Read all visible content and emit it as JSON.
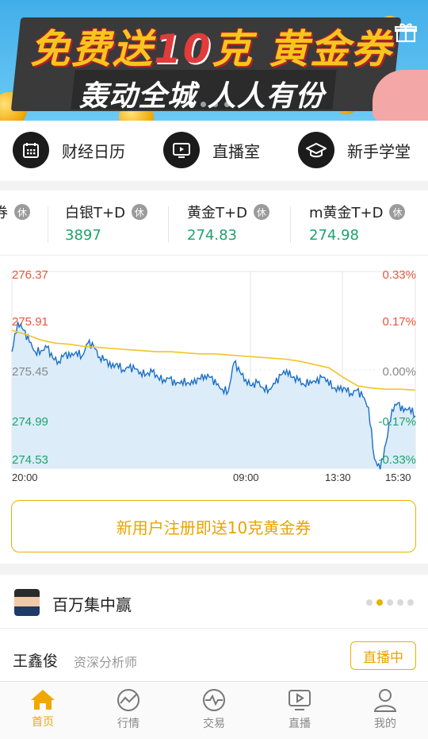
{
  "banner": {
    "title_part1": "免费送",
    "title_part2": "10",
    "title_part3": "克",
    "title_part4": "黄金券",
    "subtitle": "轰动全城 人人有份",
    "slide_count": 4,
    "active_slide": 0
  },
  "quick_menu": [
    {
      "label": "财经日历",
      "icon": "calendar-icon"
    },
    {
      "label": "直播室",
      "icon": "video-play-icon"
    },
    {
      "label": "新手学堂",
      "icon": "graduation-cap-icon"
    }
  ],
  "tickers": [
    {
      "name": "券",
      "status": "休",
      "price": ""
    },
    {
      "name": "白银T+D",
      "status": "休",
      "price": "3897"
    },
    {
      "name": "黄金T+D",
      "status": "休",
      "price": "274.83"
    },
    {
      "name": "m黄金T+D",
      "status": "休",
      "price": "274.98"
    }
  ],
  "chart": {
    "left_labels": [
      "276.37",
      "275.91",
      "275.45",
      "274.99",
      "274.53"
    ],
    "right_labels": [
      "0.33%",
      "0.17%",
      "0.00%",
      "-0.17%",
      "-0.33%"
    ],
    "x_labels": [
      "20:00",
      "09:00",
      "13:30",
      "15:30"
    ],
    "colors": {
      "up": "#e8553a",
      "flat": "#888888",
      "down": "#1ea36b",
      "price": "#1b6fc6",
      "avg": "#f2c428",
      "fill": "#dcecf9"
    }
  },
  "chart_data": {
    "type": "line",
    "ylim": [
      274.53,
      276.37
    ],
    "x_labels": [
      "20:00",
      "09:00",
      "13:30",
      "15:30"
    ],
    "series": [
      {
        "values": [
          275.62,
          275.9,
          275.82,
          275.71,
          275.62,
          275.63,
          275.66,
          275.56,
          275.53,
          275.6,
          275.57,
          275.62,
          275.58,
          275.7,
          275.67,
          275.57,
          275.55,
          275.47,
          275.51,
          275.45,
          275.47,
          275.46,
          275.43,
          275.41,
          275.43,
          275.38,
          275.36,
          275.37,
          275.31,
          275.35,
          275.33,
          275.32,
          275.37,
          275.4,
          275.38,
          275.31,
          275.27,
          275.25,
          275.52,
          275.43,
          275.36,
          275.3,
          275.33,
          275.28,
          275.27,
          275.32,
          275.4,
          275.45,
          275.38,
          275.35,
          275.31,
          275.35,
          275.33,
          275.38,
          275.36,
          275.28,
          275.26,
          275.28,
          275.23,
          275.26,
          275.2,
          275.1,
          274.62,
          274.52,
          274.77,
          275.08,
          275.14,
          275.06,
          275.1,
          275.02
        ]
      },
      {
        "values": [
          275.82,
          275.78,
          275.73,
          275.7,
          275.69,
          275.67,
          275.66,
          275.65,
          275.64,
          275.63,
          275.62,
          275.62,
          275.61,
          275.6,
          275.6,
          275.59,
          275.58,
          275.57,
          275.56,
          275.55,
          275.53,
          275.5,
          275.47,
          275.38,
          275.3,
          275.28,
          275.27,
          275.27,
          275.26
        ]
      }
    ]
  },
  "promo_text": "新用户注册即送10克黄金券",
  "analyst_section": {
    "title": "百万集中赢",
    "pager_count": 5,
    "pager_active": 1,
    "name": "王鑫俊",
    "role": "资深分析师",
    "live_button": "直播中"
  },
  "tabbar": [
    {
      "label": "首页",
      "icon": "home-icon",
      "active": true
    },
    {
      "label": "行情",
      "icon": "market-chart-icon",
      "active": false
    },
    {
      "label": "交易",
      "icon": "trade-icon",
      "active": false
    },
    {
      "label": "直播",
      "icon": "live-tv-icon",
      "active": false
    },
    {
      "label": "我的",
      "icon": "user-icon",
      "active": false
    }
  ]
}
